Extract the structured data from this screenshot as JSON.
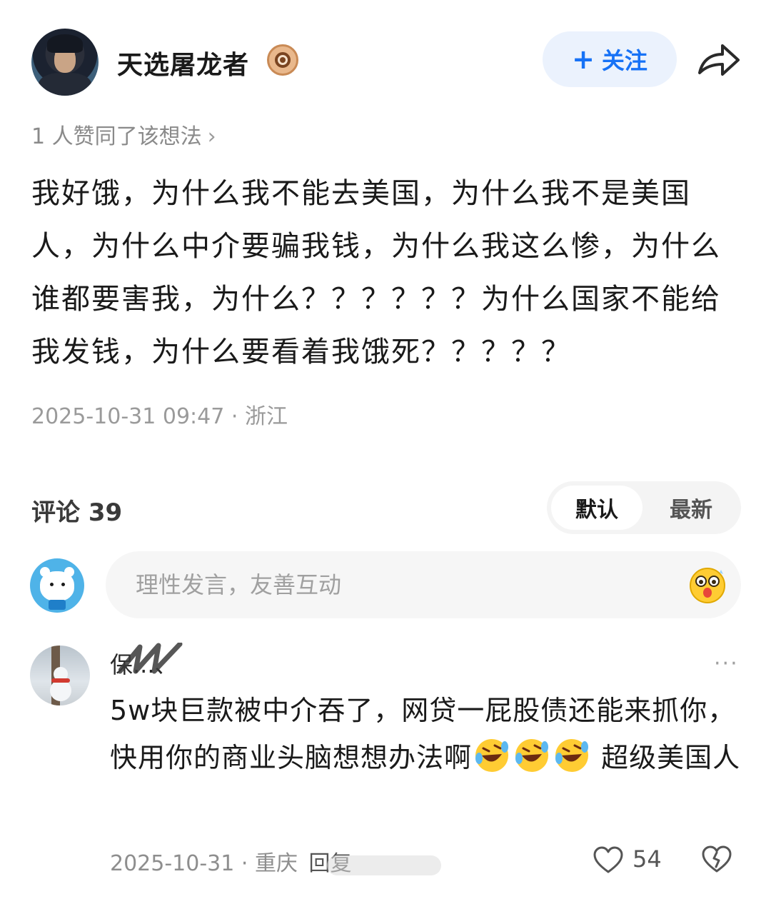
{
  "author": {
    "name": "天选屠龙者",
    "follow_label": "关注",
    "follow_plus": "+"
  },
  "post": {
    "likes_text": "1 人赞同了该想法",
    "likes_chevron": "›",
    "body": "我好饿，为什么我不能去美国，为什么我不是美国人，为什么中介要骗我钱，为什么我这么惨，为什么谁都要害我，为什么？？？？？？为什么国家不能给我发钱，为什么要看着我饿死？？？？？",
    "date": "2025-10-31 09:47",
    "separator": "·",
    "location": "浙江"
  },
  "comments_section": {
    "title": "评论 39",
    "sort_default": "默认",
    "sort_latest": "最新",
    "input_placeholder": "理性发言，友善互动"
  },
  "comment": {
    "name": "保...、",
    "more": "···",
    "text_part1": "5w块巨款被中介吞了，网贷一屁股债还能来抓你，快用你的商业头脑想想办法啊",
    "text_part2": " 超级美国人",
    "date": "2025-10-31",
    "separator": "·",
    "location": "重庆",
    "reply_label": "回复",
    "like_count": "54"
  },
  "icons": {
    "share": "share-arrow-icon",
    "badge": "creator-badge-icon",
    "emoji": "emoji-face-icon",
    "laugh": "rolling-laugh-emoji",
    "heart": "heart-outline-icon",
    "dislike": "broken-heart-icon"
  },
  "colors": {
    "accent": "#1772f6",
    "follow_bg": "#ebf2fd",
    "muted_text": "#9a9a9a"
  }
}
